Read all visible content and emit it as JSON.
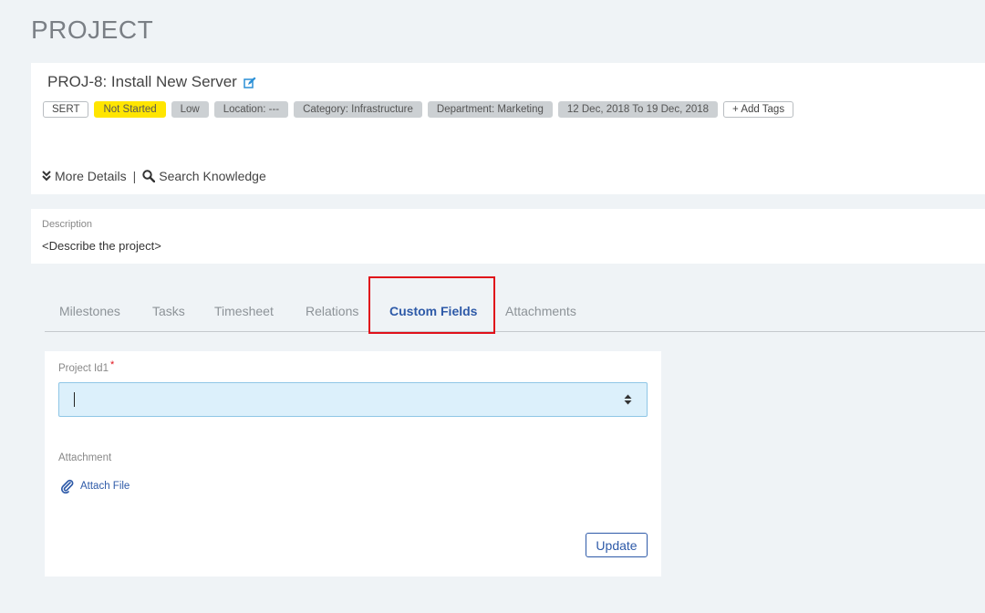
{
  "page": {
    "title": "PROJECT"
  },
  "project": {
    "title": "PROJ-8: Install New Server",
    "tags": {
      "type": "SERT",
      "status": "Not Started",
      "priority": "Low",
      "location": "Location: ---",
      "category": "Category: Infrastructure",
      "department": "Department: Marketing",
      "dates": "12 Dec, 2018 To 19 Dec, 2018",
      "add": "+ Add Tags"
    },
    "links": {
      "more_details": "More Details",
      "separator": "|",
      "search_knowledge": "Search Knowledge"
    },
    "description": {
      "label": "Description",
      "text": "<Describe the project>"
    }
  },
  "tabs": [
    {
      "label": "Milestones"
    },
    {
      "label": "Tasks"
    },
    {
      "label": "Timesheet"
    },
    {
      "label": "Relations"
    },
    {
      "label": "Custom Fields"
    },
    {
      "label": "Attachments"
    }
  ],
  "form": {
    "project_id": {
      "label": "Project Id1",
      "required_mark": "*",
      "value": ""
    },
    "attachment": {
      "label": "Attachment",
      "attach_label": "Attach File"
    },
    "update_label": "Update"
  },
  "colors": {
    "accent": "#2e5aa8",
    "status_yellow": "#ffe500",
    "highlight": "#e0101a",
    "input_bg": "#dcf0fb"
  }
}
